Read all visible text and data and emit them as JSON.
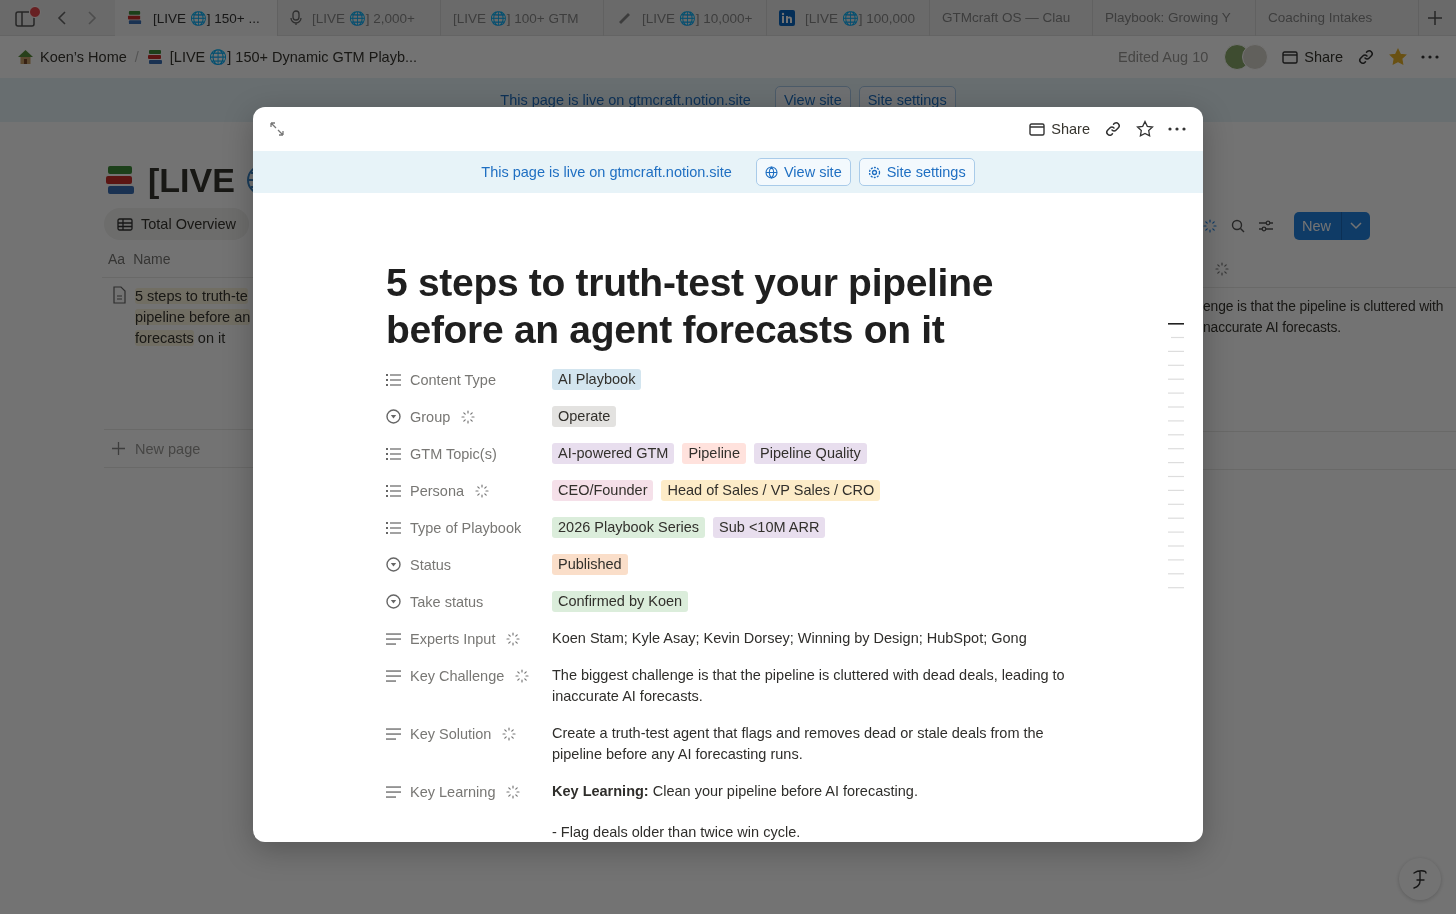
{
  "browser_tabs": [
    {
      "kind": "books",
      "label": "[LIVE 🌐] 150+ ...",
      "selected": true
    },
    {
      "kind": "microphone",
      "label": "[LIVE 🌐] 2,000+",
      "selected": false
    },
    {
      "kind": "plain",
      "label": "[LIVE 🌐] 100+ GTM",
      "selected": false
    },
    {
      "kind": "clip",
      "label": "[LIVE 🌐] 10,000+",
      "selected": false
    },
    {
      "kind": "linkedin",
      "label": "[LIVE 🌐] 100,000",
      "selected": false
    },
    {
      "kind": "plain",
      "label": "GTMcraft OS — Clau",
      "selected": false
    },
    {
      "kind": "plain",
      "label": "Playbook: Growing Y",
      "selected": false
    },
    {
      "kind": "plain",
      "label": "Coaching Intakes",
      "selected": false
    }
  ],
  "breadcrumb": [
    "Koen’s Home",
    "[LIVE 🌐] 150+ Dynamic GTM Playb..."
  ],
  "breadcrumb_separator": "/",
  "topbar": {
    "edited": "Edited Aug 10",
    "share": "Share",
    "favorite": true
  },
  "site_banner": {
    "text": "This page is live on gtmcraft.notion.site",
    "view_site": "View site",
    "site_settings": "Site settings"
  },
  "database": {
    "title": "[LIVE",
    "view_tab": "Total Overview",
    "new_button": "New",
    "name_column_type": "Aa",
    "name_column": "Name",
    "row_name_lines": [
      [
        {
          "text": "5 steps to truth-te",
          "highlighted": true
        }
      ],
      [
        {
          "text": "pipeline before an",
          "highlighted": true
        }
      ],
      [
        {
          "text": "forecasts",
          "highlighted": true
        },
        {
          "text": " on it",
          "highlighted": false
        }
      ]
    ],
    "row_challenge_lines": [
      "enge is that the pipeline is cluttered with",
      "naccurate AI forecasts."
    ],
    "new_page": "New page"
  },
  "modal": {
    "share": "Share",
    "banner": {
      "text": "This page is live on gtmcraft.notion.site",
      "view_site": "View site",
      "site_settings": "Site settings"
    },
    "title": "5 steps to truth-test your pipeline before an agent forecasts on it",
    "properties": [
      {
        "kind": "multi_select",
        "label": "Content Type",
        "ai": false,
        "tags": [
          {
            "text": "AI Playbook",
            "color": "#d3e5ef"
          }
        ]
      },
      {
        "kind": "select",
        "label": "Group",
        "ai": true,
        "tags": [
          {
            "text": "Operate",
            "color": "#e3e2e0"
          }
        ]
      },
      {
        "kind": "multi_select",
        "label": "GTM Topic(s)",
        "ai": false,
        "tags": [
          {
            "text": "AI-powered GTM",
            "color": "#e8deee"
          },
          {
            "text": "Pipeline",
            "color": "#ffe2dd"
          },
          {
            "text": "Pipeline Quality",
            "color": "#e8deee"
          }
        ]
      },
      {
        "kind": "multi_select",
        "label": "Persona",
        "ai": true,
        "tags": [
          {
            "text": "CEO/Founder",
            "color": "#f5e0e9"
          },
          {
            "text": "Head of Sales / VP Sales / CRO",
            "color": "#fdecc8"
          }
        ]
      },
      {
        "kind": "multi_select",
        "label": "Type of Playbook",
        "ai": false,
        "tags": [
          {
            "text": "2026 Playbook Series",
            "color": "#dbeddb"
          },
          {
            "text": "Sub <10M ARR",
            "color": "#e8deee"
          }
        ]
      },
      {
        "kind": "select",
        "label": "Status",
        "ai": false,
        "tags": [
          {
            "text": "Published",
            "color": "#fadec9"
          }
        ]
      },
      {
        "kind": "select",
        "label": "Take status",
        "ai": false,
        "tags": [
          {
            "text": "Confirmed by Koen",
            "color": "#dbeddb"
          }
        ]
      },
      {
        "kind": "text",
        "label": "Experts Input",
        "ai": true,
        "paragraphs": [
          "Koen Stam; Kyle Asay; Kevin Dorsey; Winning by Design; HubSpot; Gong"
        ]
      },
      {
        "kind": "text",
        "label": "Key Challenge",
        "ai": true,
        "paragraphs": [
          "The biggest challenge is that the pipeline is cluttered with dead deals, leading to inaccurate AI forecasts."
        ]
      },
      {
        "kind": "text",
        "label": "Key Solution",
        "ai": true,
        "paragraphs": [
          "Create a truth-test agent that flags and removes dead or stale deals from the pipeline before any AI forecasting runs."
        ]
      },
      {
        "kind": "text",
        "label": "Key Learning",
        "ai": true,
        "paragraphs": [
          "**Key Learning:** Clean your pipeline before AI forecasting.",
          "- Flag deals older than twice win cycle."
        ]
      }
    ]
  }
}
